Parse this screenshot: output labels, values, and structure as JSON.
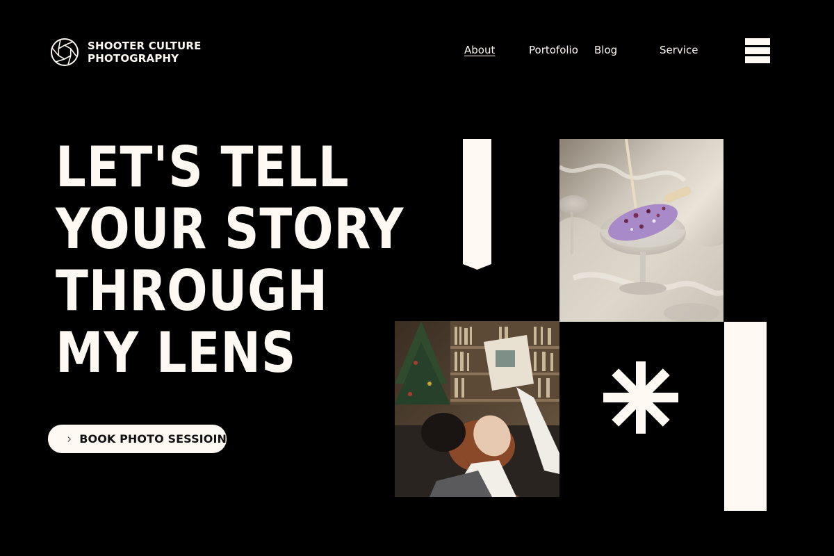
{
  "brand": {
    "line1": "SHOOTER CULTURE",
    "line2": "PHOTOGRAPHY",
    "icon": "camera-aperture-icon"
  },
  "nav": {
    "items": [
      {
        "label": "About",
        "active": true
      },
      {
        "label": "Portofolio",
        "active": false
      },
      {
        "label": "Blog",
        "active": false
      },
      {
        "label": "Service",
        "active": false
      }
    ],
    "menu_icon": "hamburger-menu-icon"
  },
  "hero": {
    "title_lines": [
      "LET'S TELL",
      "YOUR STORY",
      "THROUGH",
      "MY LENS"
    ]
  },
  "cta": {
    "label": "BOOK PHOTO SESSIOIN",
    "icon": "chevron-right-icon"
  },
  "gallery": {
    "photos": [
      {
        "name": "popsicle-photo",
        "subject": "ice-cream bar in coupe glass"
      },
      {
        "name": "reading-photo",
        "subject": "person reading book in library"
      }
    ],
    "decor_icons": [
      "ribbon-bookmark-icon",
      "asterisk-icon"
    ]
  },
  "colors": {
    "background": "#000000",
    "foreground": "#fdf8f2",
    "button_text": "#111111"
  }
}
